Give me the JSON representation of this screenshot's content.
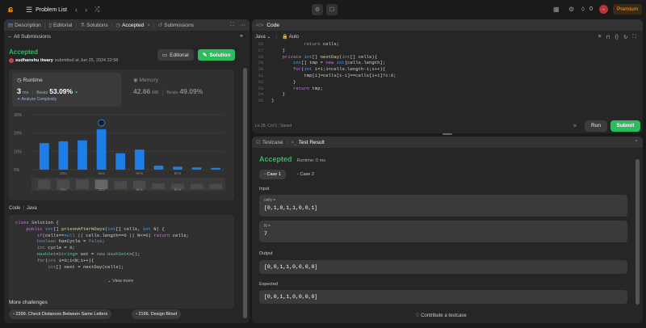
{
  "nav": {
    "title": "Problem List",
    "premium": "Premium",
    "streak": "0"
  },
  "left": {
    "tabs": [
      {
        "label": "Description"
      },
      {
        "label": "Editorial"
      },
      {
        "label": "Solutions"
      },
      {
        "label": "Accepted"
      },
      {
        "label": "Submissions"
      }
    ],
    "back_label": "All Submissions",
    "status": "Accepted",
    "user": "sudhanshu tiwary",
    "submitted": "submitted at Jun 25, 2024 22:58",
    "editorial_btn": "Editorial",
    "solution_btn": "Solution",
    "runtime_label": "Runtime",
    "runtime_value": "3",
    "runtime_unit": "ms",
    "beats_label": "Beats",
    "runtime_beats": "53.09%",
    "analyze": "Analyze Complexity",
    "memory_label": "Memory",
    "memory_value": "42.66",
    "memory_unit": "MB",
    "memory_beats": "49.09%",
    "code_label": "Code",
    "lang": "Java",
    "view_more": "View more",
    "more_challenges": "More challenges",
    "challenges": [
      "2399. Check Distances Between Same Letters",
      "2166. Design Bitset"
    ],
    "left_code": [
      [
        [
          "class ",
          "kw"
        ],
        [
          "Solution {",
          "pl"
        ]
      ],
      [
        [
          "    public ",
          "kw"
        ],
        [
          "int",
          "bl"
        ],
        [
          "[] ",
          "pl"
        ],
        [
          "prisonAfterNDays",
          "fn"
        ],
        [
          "(",
          "pl"
        ],
        [
          "int",
          "bl"
        ],
        [
          "[] cells, ",
          "pl"
        ],
        [
          "int",
          "bl"
        ],
        [
          " N) {",
          "pl"
        ]
      ],
      [
        [
          "        if",
          "kw"
        ],
        [
          "(cells==",
          "pl"
        ],
        [
          "null",
          "bl"
        ],
        [
          " || cells.length==",
          "pl"
        ],
        [
          "0",
          "nm"
        ],
        [
          " || N<=",
          "pl"
        ],
        [
          "0",
          "nm"
        ],
        [
          ") ",
          "pl"
        ],
        [
          "return",
          "kw"
        ],
        [
          " cells;",
          "pl"
        ]
      ],
      [
        [
          "        boolean",
          "bl"
        ],
        [
          " hasCycle = ",
          "pl"
        ],
        [
          "false",
          "bl"
        ],
        [
          ";",
          "pl"
        ]
      ],
      [
        [
          "        int",
          "bl"
        ],
        [
          " cycle = ",
          "pl"
        ],
        [
          "0",
          "nm"
        ],
        [
          ";",
          "pl"
        ]
      ],
      [
        [
          "        HashSet",
          "ty"
        ],
        [
          "<",
          "pl"
        ],
        [
          "String",
          "ty"
        ],
        [
          "> set = ",
          "pl"
        ],
        [
          "new ",
          "kw"
        ],
        [
          "HashSet",
          "ty"
        ],
        [
          "<>();",
          "pl"
        ]
      ],
      [
        [
          "        for",
          "kw"
        ],
        [
          "(",
          "pl"
        ],
        [
          "int",
          "bl"
        ],
        [
          " i=",
          "pl"
        ],
        [
          "0",
          "nm"
        ],
        [
          ";i<N;i++){",
          "pl"
        ]
      ],
      [
        [
          "            int",
          "bl"
        ],
        [
          "[] next = ",
          "pl"
        ],
        [
          "nextDay",
          "fn"
        ],
        [
          "(cells);",
          "pl"
        ]
      ]
    ]
  },
  "chart_data": {
    "type": "bar",
    "categories": [
      "b1",
      "b2",
      "b3",
      "b4",
      "b5",
      "b6",
      "b7",
      "b8",
      "b9",
      "b10"
    ],
    "values": [
      14.5,
      15.5,
      16,
      22,
      9,
      11,
      2.2,
      1.6,
      1.2,
      1.0
    ],
    "highlight_index": 3,
    "ylim": [
      0,
      30
    ],
    "yticks": [
      "30%",
      "20%",
      "10%",
      "0%"
    ],
    "xticks": [
      "2ms",
      "4ms",
      "6ms",
      "8ms"
    ],
    "grid": true
  },
  "code": {
    "title": "Code",
    "lang": "Java",
    "auto": "Auto",
    "start_line": 26,
    "lines": [
      [
        [
          "            return ",
          "kw"
        ],
        [
          "cells;",
          "pl"
        ]
      ],
      [
        [
          "    }",
          "pl"
        ]
      ],
      [
        [
          "    private ",
          "kw"
        ],
        [
          "int",
          "bl"
        ],
        [
          "[] ",
          "pl"
        ],
        [
          "nextDay",
          "fn"
        ],
        [
          "(",
          "pl"
        ],
        [
          "int",
          "bl"
        ],
        [
          "[] cells){",
          "pl"
        ]
      ],
      [
        [
          "        int",
          "bl"
        ],
        [
          "[] tmp = ",
          "pl"
        ],
        [
          "new ",
          "kw"
        ],
        [
          "int",
          "bl"
        ],
        [
          "[cells.length];",
          "pl"
        ]
      ],
      [
        [
          "        for",
          "kw"
        ],
        [
          "(",
          "pl"
        ],
        [
          "int",
          "bl"
        ],
        [
          " i=",
          "pl"
        ],
        [
          "1",
          "nm"
        ],
        [
          ";i<cells.length-",
          "pl"
        ],
        [
          "1",
          "nm"
        ],
        [
          ";i++){",
          "pl"
        ]
      ],
      [
        [
          "            tmp[i]=cells[i-",
          "pl"
        ],
        [
          "1",
          "nm"
        ],
        [
          "]==cells[i+",
          "pl"
        ],
        [
          "1",
          "nm"
        ],
        [
          "]?",
          "pl"
        ],
        [
          "1",
          "nm"
        ],
        [
          ":",
          "pl"
        ],
        [
          "0",
          "nm"
        ],
        [
          ";",
          "pl"
        ]
      ],
      [
        [
          "        }",
          "pl"
        ]
      ],
      [
        [
          "        return ",
          "kw"
        ],
        [
          "tmp;",
          "pl"
        ]
      ],
      [
        [
          "    }",
          "pl"
        ]
      ],
      [
        [
          "}",
          "pl"
        ]
      ]
    ],
    "status": "Ln 28, Col 5",
    "saved": "Saved",
    "run": "Run",
    "submit": "Submit"
  },
  "result": {
    "tab1": "Testcase",
    "tab2": "Test Result",
    "status": "Accepted",
    "runtime": "Runtime: 0 ms",
    "case1": "Case 1",
    "case2": "Case 2",
    "input": "Input",
    "cells_label": "cells =",
    "cells_value": "[0,1,0,1,1,0,0,1]",
    "n_label": "N =",
    "n_value": "7",
    "output": "Output",
    "output_value": "[0,0,1,1,0,0,0,0]",
    "expected": "Expected",
    "expected_value": "[0,0,1,1,0,0,0,0]",
    "contribute": "Contribute a testcase"
  }
}
